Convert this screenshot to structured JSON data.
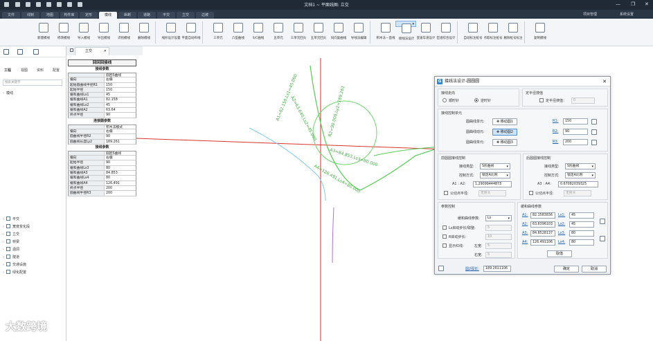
{
  "window": {
    "title": "文档1 ~ 平面线图: 立交"
  },
  "tabs": [
    "文件",
    "线制",
    "地图",
    "构件库",
    "定形",
    "模线",
    "纵断",
    "道路",
    "平交",
    "立交",
    "边坡"
  ],
  "active_tab_index": 5,
  "topright": {
    "project": "项目管理",
    "settings": "系统设置"
  },
  "ribbon": [
    {
      "label": "新建模线"
    },
    {
      "label": "修改模线"
    },
    {
      "label": "导入模线"
    },
    {
      "label": "导出模线"
    },
    {
      "label": "识别模线"
    },
    {
      "label": "删除模线"
    },
    {
      "label": "线形设计设置"
    },
    {
      "label": "平面自动布线"
    },
    {
      "label": "三单元"
    },
    {
      "label": "凸型曲线"
    },
    {
      "label": "S/C曲线"
    },
    {
      "label": "五单元"
    },
    {
      "label": "三单元回头"
    },
    {
      "label": "五单元回头"
    },
    {
      "label": "同向复曲线"
    },
    {
      "label": "导线法编辑"
    },
    {
      "label": "积木法－直线"
    },
    {
      "label": "接线法设计"
    },
    {
      "label": "变速车道设计"
    },
    {
      "label": "匝道综合设计"
    },
    {
      "label": "自动标注桩号"
    },
    {
      "label": "点取标注桩号"
    },
    {
      "label": "删除桩号标注"
    },
    {
      "label": "复制模线"
    }
  ],
  "active_ribbon_index": 17,
  "left_panel": {
    "tabs": [
      "工程",
      "视图",
      "资料",
      "配置"
    ],
    "search_placeholder": "搜索关键字",
    "tree_top": "模线",
    "tree_bottom": [
      "平交",
      "宽度变化段",
      "立交",
      "桥梁",
      "涵洞",
      "隧道",
      "交通设施",
      "绿化配置"
    ]
  },
  "doc_tab": "立交",
  "table": {
    "title": "回回回接线",
    "sections": [
      {
        "header": "接线参数",
        "rows": [
          [
            "",
            "圆回S曲线"
          ],
          [
            "偏向",
            "右偏"
          ],
          [
            "起始圆曲线半径R1",
            "150"
          ],
          [
            "起始半径",
            "150"
          ],
          [
            "缓和曲线Ls1",
            "45"
          ],
          [
            "缓和曲线A1",
            "82.158"
          ],
          [
            "缓和曲线Ls2",
            "45"
          ],
          [
            "缓和曲线A2",
            "63.64"
          ],
          [
            "终点半径",
            "90"
          ]
        ]
      },
      {
        "header": "连接圆参数",
        "rows": [
          [
            "",
            "积木法模式"
          ],
          [
            "偏向",
            "右偏"
          ],
          [
            "圆曲线半径R2",
            "90"
          ],
          [
            "圆曲线长度Ly2",
            "189.261"
          ]
        ]
      },
      {
        "header": "接线参数",
        "rows": [
          [
            "",
            "圆回S曲线"
          ],
          [
            "偏向",
            "右偏"
          ],
          [
            "起始半径",
            "90"
          ],
          [
            "缓和曲线Ls3",
            "80"
          ],
          [
            "缓和曲线A3",
            "84.853"
          ],
          [
            "缓和曲线Ls4",
            "80"
          ],
          [
            "缓和曲线A4",
            "126.491"
          ],
          [
            "终点半径",
            "200"
          ],
          [
            "圆曲线半径R3",
            "200"
          ]
        ]
      }
    ]
  },
  "canvas_labels": {
    "a1": "A1=82.158,Ls1=45.000",
    "a2": "A2=63.640,Ls2=45.000",
    "r2": "R2=90.000,Ly2=189.261",
    "a3": "A3=84.853,Ls3=80.000",
    "a4": "A4=126.491,Ls4=80.000"
  },
  "dialog": {
    "title": "接线法设计-圆圆圆",
    "logo": "G",
    "dir_title": "接线走向",
    "dir_cw": "顺时针",
    "dir_ccw": "逆时针",
    "dir_selected": "ccw",
    "fix_title": "定半径搜值",
    "fix_label": "定半径搜值：",
    "fix_value": "0",
    "ctrl_title": "接线控制单元",
    "units": [
      {
        "label": "圆曲线单元:",
        "btn": "移动圆1",
        "r": "R1:",
        "val": "150"
      },
      {
        "label": "圆曲线动元:",
        "btn": "移动圆2",
        "r": "R2:",
        "val": "90"
      },
      {
        "label": "圆曲线单元:",
        "btn": "移动圆3",
        "r": "R3:",
        "val": "200"
      }
    ],
    "front_title": "前圆圆接线控制",
    "back_title": "后圆圆接线控制",
    "type_label": "接线类型:",
    "type_value": "S形曲线",
    "mode_label": "控制方式:",
    "mode_value": "锁定A比例",
    "a12_label": "A1 : A2:",
    "a12_value": "1.29099444873",
    "a34_label": "A3 : A4:",
    "a34_value": "0.67082039325",
    "common_label": "公切点半径:",
    "common_value": "无穷大",
    "param_title": "参数控制",
    "ease_label": "缓和曲线参数:",
    "ease_value": "Ls",
    "ls_step_label": "Ls启动步长/取整:",
    "ls_step_value": "5",
    "r_step_label": "R启动步长:",
    "r_step_value": "10",
    "show_label": "显示红线:",
    "left_label": "左宽:",
    "left_value": "5",
    "right_label": "右宽:",
    "right_value": "5",
    "ease_title": "缓和曲线参数",
    "ease_rows": [
      {
        "a": "A1:",
        "av": "82.1583836",
        "l": "Ls1:",
        "lv": "45"
      },
      {
        "a": "A2:",
        "av": "63.6396103",
        "l": "Ls2:",
        "lv": "45"
      },
      {
        "a": "A3:",
        "av": "84.8528137",
        "l": "Ls3:",
        "lv": "80"
      },
      {
        "a": "A4:",
        "av": "126.491106",
        "l": "Ls4:",
        "lv": "80"
      }
    ],
    "fetch_btn": "取值",
    "ly2_label": "圆2弧长:",
    "ly2_value": "189.2611106",
    "ok": "确定",
    "cancel": "取消"
  },
  "watermark": "大数跨境"
}
